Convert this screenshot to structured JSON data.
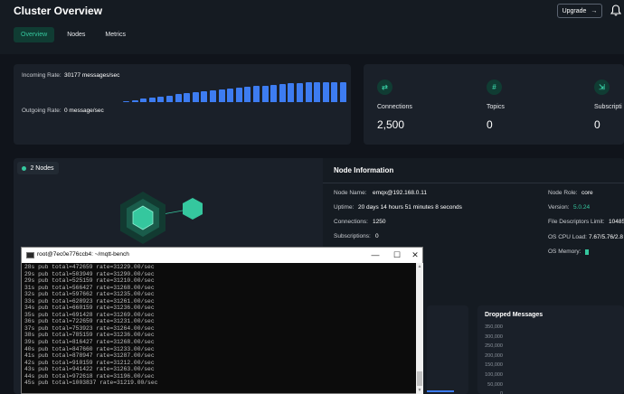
{
  "header": {
    "title": "Cluster Overview",
    "upgrade_label": "Upgrade",
    "tabs": [
      {
        "label": "Overview"
      },
      {
        "label": "Nodes"
      },
      {
        "label": "Metrics"
      }
    ]
  },
  "rates": {
    "incoming_label": "Incoming Rate:",
    "incoming_value": "30177 messages/sec",
    "outgoing_label": "Outgoing Rate:",
    "outgoing_value": "0 message/sec",
    "bar_levels": [
      0.04,
      0.1,
      0.16,
      0.22,
      0.28,
      0.34,
      0.4,
      0.46,
      0.52,
      0.56,
      0.6,
      0.64,
      0.68,
      0.72,
      0.76,
      0.8,
      0.84,
      0.88,
      0.92,
      0.95,
      0.97,
      0.99,
      1.0,
      1.0,
      1.0,
      1.0
    ]
  },
  "stats": {
    "connections_label": "Connections",
    "connections_value": "2,500",
    "topics_label": "Topics",
    "topics_value": "0",
    "subscriptions_label": "Subscripti",
    "subscriptions_value": "0"
  },
  "nodes": {
    "badge": "2 Nodes"
  },
  "node_info": {
    "title": "Node Information",
    "node_name_label": "Node Name:",
    "node_name": "emqx@192.168.0.11",
    "uptime_label": "Uptime:",
    "uptime": "20 days 14 hours 51 minutes 8 seconds",
    "connections_label": "Connections:",
    "connections": "1250",
    "subscriptions_label": "Subscriptions:",
    "subscriptions": "0",
    "role_label": "Node Role:",
    "role": "core",
    "version_label": "Version:",
    "version": "5.0.24",
    "fd_label": "File Descriptors Limit:",
    "fd": "10485",
    "cpu_label": "OS CPU Load:",
    "cpu": "7.67/5.76/2.8",
    "memory_label": "OS Memory:",
    "memory_level": 0.05,
    "accent_color": "#35c79e"
  },
  "dropped": {
    "title": "Dropped Messages",
    "yticks": [
      "350,000",
      "300,000",
      "250,000",
      "200,000",
      "150,000",
      "100,000",
      "50,000",
      "0"
    ]
  },
  "terminal": {
    "title": "root@7ec0e776ccb4: ~/mqtt-bench",
    "lines": [
      "28s pub total=472659 rate=31229.00/sec",
      "29s pub total=503949 rate=31290.00/sec",
      "29s pub total=525159 rate=31210.00/sec",
      "31s pub total=566427 rate=31268.00/sec",
      "32s pub total=597662 rate=31235.00/sec",
      "33s pub total=628923 rate=31261.00/sec",
      "34s pub total=660159 rate=31236.00/sec",
      "35s pub total=691428 rate=31269.00/sec",
      "36s pub total=722659 rate=31231.00/sec",
      "37s pub total=753923 rate=31264.00/sec",
      "38s pub total=785159 rate=31236.00/sec",
      "39s pub total=816427 rate=31268.00/sec",
      "40s pub total=847660 rate=31233.00/sec",
      "41s pub total=878947 rate=31287.00/sec",
      "42s pub total=910159 rate=31212.00/sec",
      "43s pub total=941422 rate=31263.00/sec",
      "44s pub total=972618 rate=31196.00/sec",
      "45s pub total=1003837 rate=31219.00/sec"
    ]
  }
}
